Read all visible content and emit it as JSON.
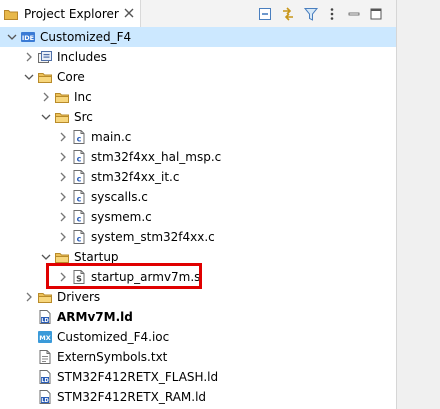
{
  "tab": {
    "title": "Project Explorer",
    "close_icon": "close-icon"
  },
  "toolbar": {
    "buttons": [
      {
        "name": "collapse-all-button",
        "icon": "collapse-all-icon"
      },
      {
        "name": "link-with-editor-button",
        "icon": "link-icon"
      },
      {
        "name": "filter-button",
        "icon": "filter-icon"
      },
      {
        "name": "view-menu-button",
        "icon": "more-vertical-icon"
      }
    ]
  },
  "tree": [
    {
      "label": "Customized_F4",
      "level": 0,
      "expand": "expanded",
      "icon": "project-icon",
      "selected": true
    },
    {
      "label": "Includes",
      "level": 1,
      "expand": "collapsed",
      "icon": "includes-icon"
    },
    {
      "label": "Core",
      "level": 1,
      "expand": "expanded",
      "icon": "folder-icon"
    },
    {
      "label": "Inc",
      "level": 2,
      "expand": "collapsed",
      "icon": "folder-icon"
    },
    {
      "label": "Src",
      "level": 2,
      "expand": "expanded",
      "icon": "folder-icon"
    },
    {
      "label": "main.c",
      "level": 3,
      "expand": "collapsed",
      "icon": "c-file-icon"
    },
    {
      "label": "stm32f4xx_hal_msp.c",
      "level": 3,
      "expand": "collapsed",
      "icon": "c-file-icon"
    },
    {
      "label": "stm32f4xx_it.c",
      "level": 3,
      "expand": "collapsed",
      "icon": "c-file-icon"
    },
    {
      "label": "syscalls.c",
      "level": 3,
      "expand": "collapsed",
      "icon": "c-file-icon"
    },
    {
      "label": "sysmem.c",
      "level": 3,
      "expand": "collapsed",
      "icon": "c-file-icon"
    },
    {
      "label": "system_stm32f4xx.c",
      "level": 3,
      "expand": "collapsed",
      "icon": "c-file-icon"
    },
    {
      "label": "Startup",
      "level": 2,
      "expand": "expanded",
      "icon": "folder-icon"
    },
    {
      "label": "startup_armv7m.s",
      "level": 3,
      "expand": "collapsed",
      "icon": "s-file-icon",
      "highlighted": true
    },
    {
      "label": "Drivers",
      "level": 1,
      "expand": "collapsed",
      "icon": "folder-icon"
    },
    {
      "label": "ARMv7M.ld",
      "level": 1,
      "expand": "none",
      "icon": "ld-file-icon",
      "bold": true
    },
    {
      "label": "Customized_F4.ioc",
      "level": 1,
      "expand": "none",
      "icon": "mx-file-icon"
    },
    {
      "label": "ExternSymbols.txt",
      "level": 1,
      "expand": "none",
      "icon": "txt-file-icon"
    },
    {
      "label": "STM32F412RETX_FLASH.ld",
      "level": 1,
      "expand": "none",
      "icon": "ld-file-icon"
    },
    {
      "label": "STM32F412RETX_RAM.ld",
      "level": 1,
      "expand": "none",
      "icon": "ld-file-icon"
    }
  ],
  "colors": {
    "selection": "#cce8ff",
    "highlight_border": "#e00000",
    "folder": "#e8b84a",
    "accent": "#3a7bd5"
  }
}
